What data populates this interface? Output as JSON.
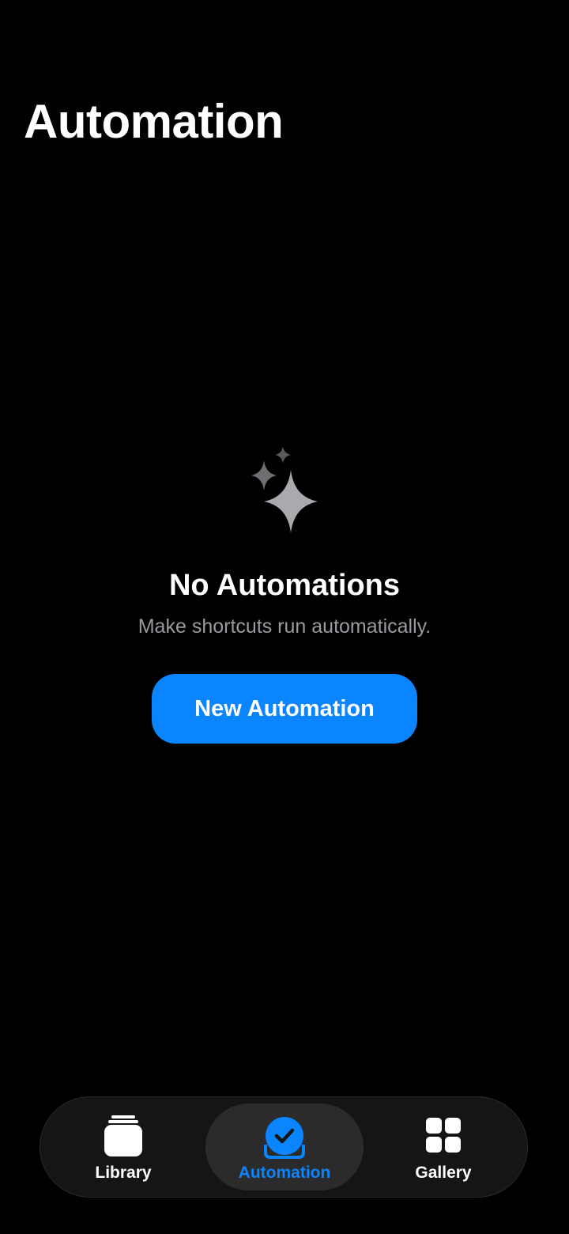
{
  "header": {
    "title": "Automation"
  },
  "empty_state": {
    "icon": "sparkles-icon",
    "title": "No Automations",
    "subtitle": "Make shortcuts run automatically.",
    "button_label": "New Automation"
  },
  "tab_bar": {
    "selected": "Automation",
    "tabs": [
      {
        "label": "Library",
        "icon": "library-stack-icon"
      },
      {
        "label": "Automation",
        "icon": "automation-check-icon"
      },
      {
        "label": "Gallery",
        "icon": "gallery-grid-icon"
      }
    ]
  },
  "colors": {
    "background": "#000000",
    "accent": "#0a84ff",
    "subtitle": "#9a9aa0",
    "tab_bar": "#151515",
    "selected_tab": "#2b2b2b"
  }
}
